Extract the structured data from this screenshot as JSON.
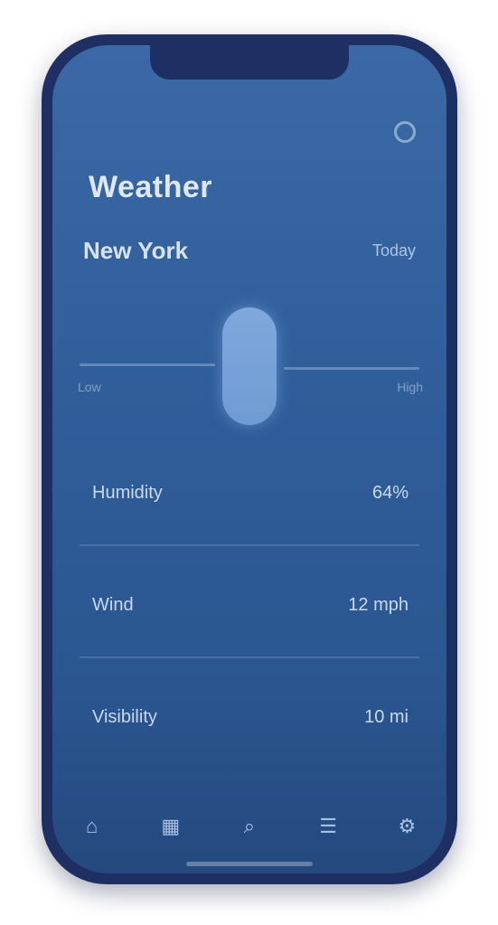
{
  "screen": {
    "title": "Weather"
  },
  "header_row": {
    "left": "New York",
    "right": "Today"
  },
  "dial": {
    "left_label": "Low",
    "right_label": "High"
  },
  "sections": [
    {
      "label": "Humidity",
      "value": "64%"
    },
    {
      "label": "Wind",
      "value": "12 mph"
    },
    {
      "label": "Visibility",
      "value": "10 mi"
    }
  ],
  "tabbar": {
    "items": [
      {
        "name": "home",
        "glyph": "⌂"
      },
      {
        "name": "map",
        "glyph": "▦"
      },
      {
        "name": "search",
        "glyph": "⌕"
      },
      {
        "name": "list",
        "glyph": "☰"
      },
      {
        "name": "settings",
        "glyph": "⚙"
      }
    ]
  }
}
